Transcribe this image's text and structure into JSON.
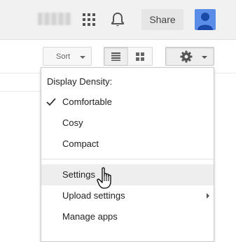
{
  "header": {
    "share_label": "Share",
    "icons": [
      "apps-grid-icon",
      "notifications-bell-icon",
      "avatar-person-icon"
    ]
  },
  "toolbar": {
    "sort_label": "Sort",
    "view_icons": [
      "list-view-icon",
      "grid-view-icon"
    ],
    "settings_icon": "gear-icon"
  },
  "settings_menu": {
    "display_density_heading": "Display Density:",
    "density_options": [
      {
        "label": "Comfortable",
        "selected": true
      },
      {
        "label": "Cosy",
        "selected": false
      },
      {
        "label": "Compact",
        "selected": false
      }
    ],
    "actions": [
      {
        "label": "Settings",
        "hovered": true
      },
      {
        "label": "Upload settings",
        "has_submenu": true
      },
      {
        "label": "Manage apps"
      }
    ]
  },
  "colors": {
    "topbar_bg": "#f1f1f1",
    "share_button_bg": "#e6e6e6",
    "avatar_bg": "#5a8de8",
    "menu_hover_bg": "#eeeeee"
  }
}
